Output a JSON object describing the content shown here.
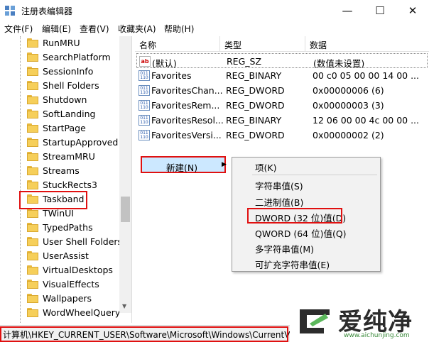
{
  "window": {
    "title": "注册表编辑器",
    "minimize_glyph": "—",
    "maximize_glyph": "☐",
    "close_glyph": "✕"
  },
  "menubar": {
    "items": [
      "文件(F)",
      "编辑(E)",
      "查看(V)",
      "收藏夹(A)",
      "帮助(H)"
    ]
  },
  "tree": {
    "items": [
      {
        "label": "RunMRU"
      },
      {
        "label": "SearchPlatform"
      },
      {
        "label": "SessionInfo"
      },
      {
        "label": "Shell Folders"
      },
      {
        "label": "Shutdown"
      },
      {
        "label": "SoftLanding"
      },
      {
        "label": "StartPage"
      },
      {
        "label": "StartupApproved"
      },
      {
        "label": "StreamMRU"
      },
      {
        "label": "Streams"
      },
      {
        "label": "StuckRects3"
      },
      {
        "label": "Taskband",
        "highlighted": true
      },
      {
        "label": "TWinUI"
      },
      {
        "label": "TypedPaths"
      },
      {
        "label": "User Shell Folders"
      },
      {
        "label": "UserAssist"
      },
      {
        "label": "VirtualDesktops"
      },
      {
        "label": "VisualEffects"
      },
      {
        "label": "Wallpapers"
      },
      {
        "label": "WordWheelQuery"
      }
    ]
  },
  "values": {
    "columns": [
      "名称",
      "类型",
      "数据"
    ],
    "rows": [
      {
        "icon": "string-value-icon",
        "name": "(默认)",
        "type": "REG_SZ",
        "data": "(数值未设置)"
      },
      {
        "icon": "binary-value-icon",
        "name": "Favorites",
        "type": "REG_BINARY",
        "data": "00 c0 05 00 00 14 00 ..."
      },
      {
        "icon": "binary-value-icon",
        "name": "FavoritesChan...",
        "type": "REG_DWORD",
        "data": "0x00000006 (6)"
      },
      {
        "icon": "binary-value-icon",
        "name": "FavoritesRem...",
        "type": "REG_DWORD",
        "data": "0x00000003 (3)"
      },
      {
        "icon": "binary-value-icon",
        "name": "FavoritesResol...",
        "type": "REG_BINARY",
        "data": "12 06 00 00 4c 00 00 ..."
      },
      {
        "icon": "binary-value-icon",
        "name": "FavoritesVersi...",
        "type": "REG_DWORD",
        "data": "0x00000002 (2)"
      }
    ]
  },
  "context_menu": {
    "new_label": "新建(N)",
    "submenu_arrow": "▶",
    "submenu": [
      "项(K)",
      "字符串值(S)",
      "二进制值(B)",
      "DWORD (32 位)值(D)",
      "QWORD (64 位)值(Q)",
      "多字符串值(M)",
      "可扩充字符串值(E)"
    ]
  },
  "statusbar": {
    "path": "计算机\\HKEY_CURRENT_USER\\Software\\Microsoft\\Windows\\CurrentVersion"
  },
  "watermark": {
    "brand": "爱纯净",
    "url": "www.aichunjing.com"
  },
  "colors": {
    "highlight_red": "#e01010",
    "menu_hover": "#cce8ff",
    "folder_yellow": "#f6cf5a"
  }
}
